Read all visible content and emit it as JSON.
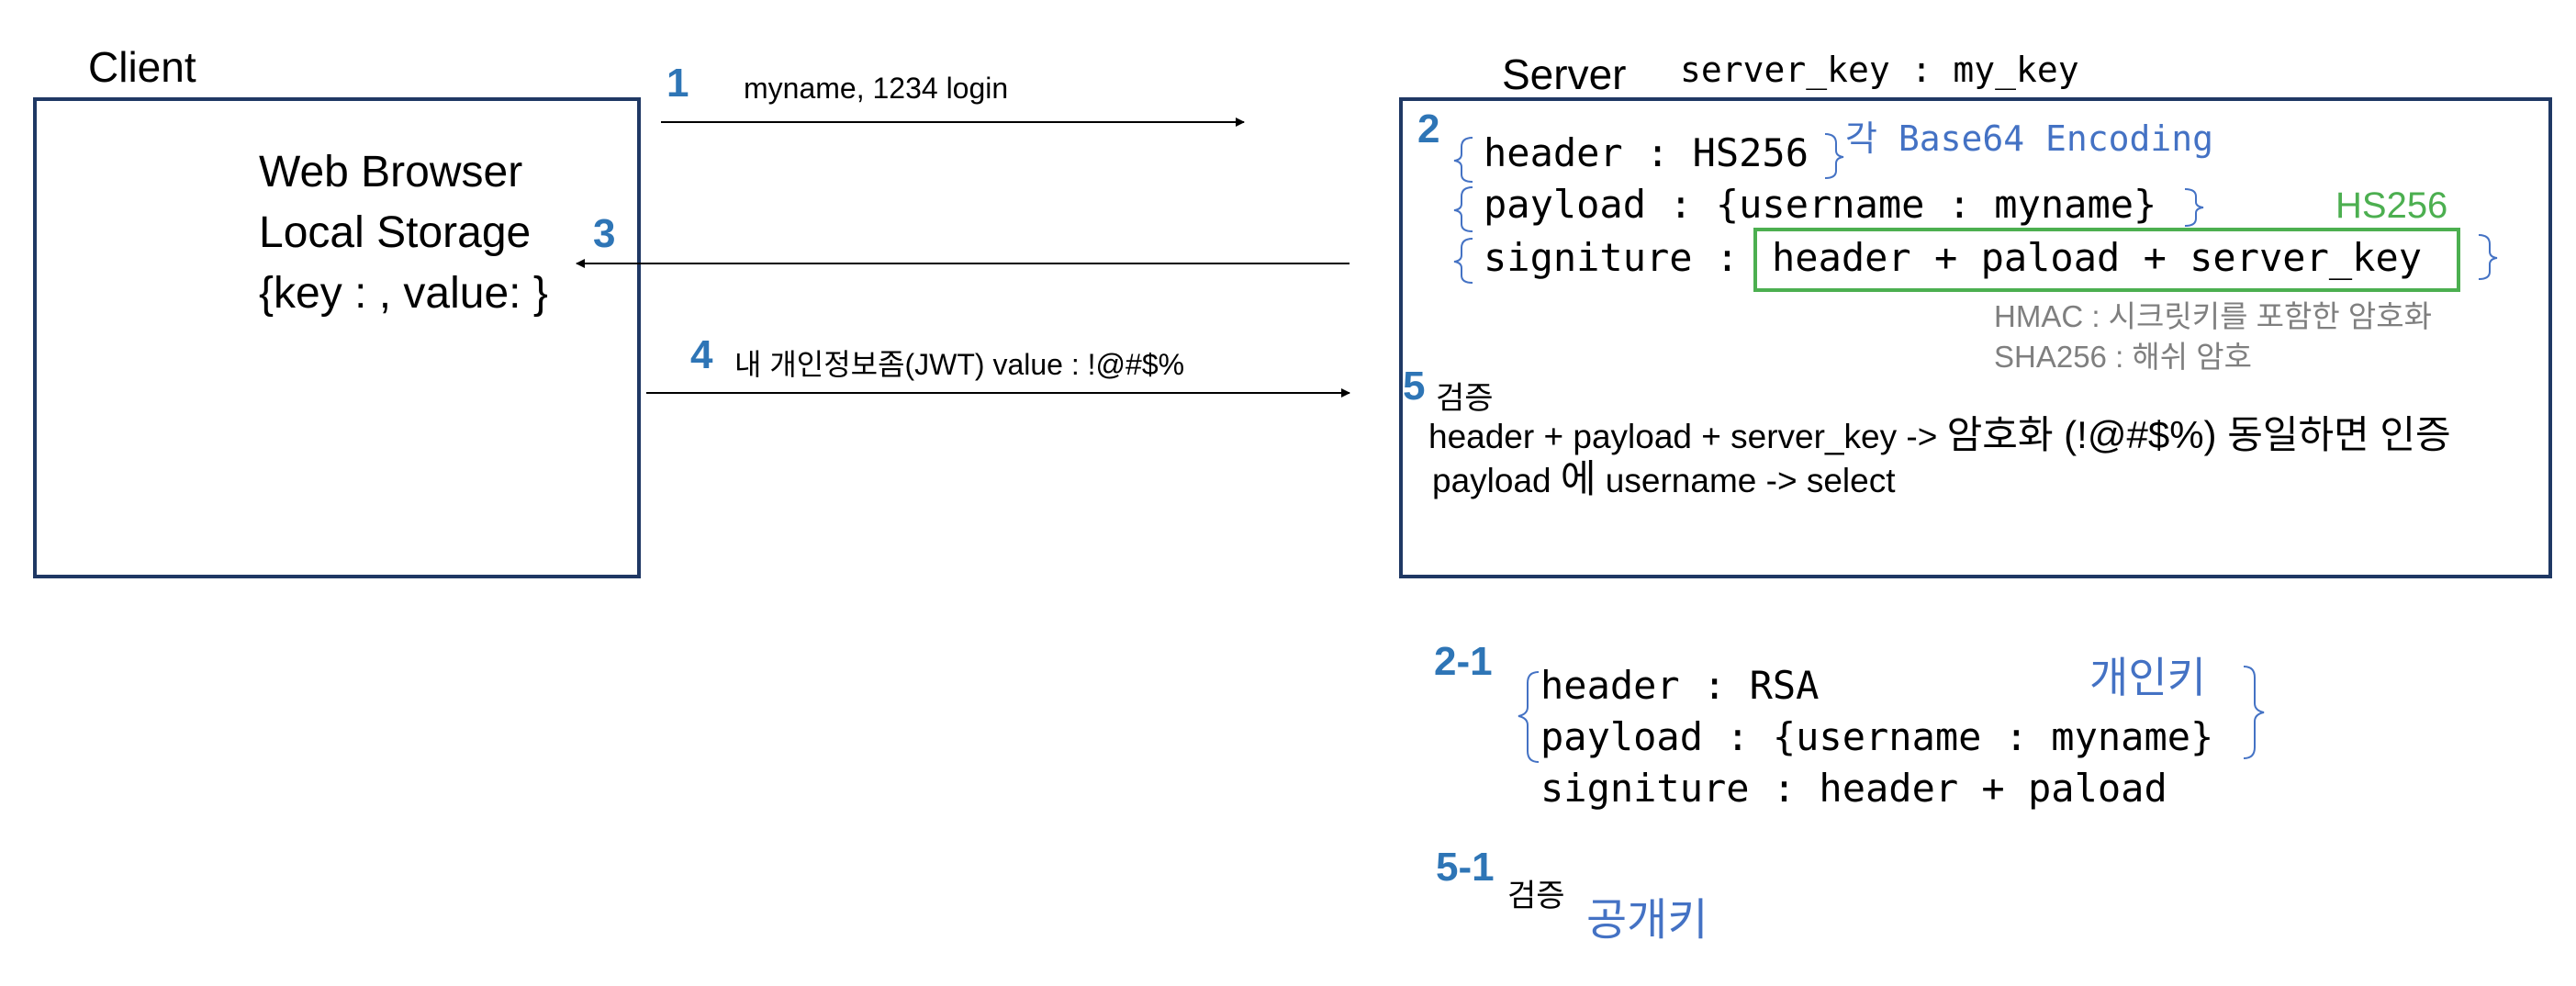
{
  "client": {
    "title": "Client",
    "line1": "Web Browser",
    "line2": "Local Storage",
    "line3": "{key : , value: }"
  },
  "server": {
    "title": "Server",
    "key_label": "server_key : my_key"
  },
  "steps": {
    "s1": {
      "num": "1",
      "text": "myname, 1234 login"
    },
    "s2": {
      "num": "2"
    },
    "s3": {
      "num": "3"
    },
    "s4": {
      "num": "4",
      "text": "내 개인정보좀(JWT) value : !@#$%"
    },
    "s5": {
      "num": "5",
      "label": "검증"
    },
    "s2_1": {
      "num": "2-1"
    },
    "s5_1": {
      "num": "5-1",
      "label": "검증"
    }
  },
  "jwt_hs": {
    "header": "header : HS256",
    "payload": "payload : {username : myname}",
    "sig_label": "signiture :",
    "sig_formula": "header + paload + server_key",
    "encoding_note": "각 Base64 Encoding",
    "alg_note": "HS256",
    "hmac_note": "HMAC : 시크릿키를 포함한 암호화",
    "sha_note": "SHA256 : 해쉬 암호"
  },
  "verify": {
    "line1_a": "header + payload + server_key -> ",
    "line1_b": "암호화 (!@#$%) 동일하면 인증",
    "line2_a": "payload ",
    "line2_b": "에",
    "line2_c": " username -> select"
  },
  "jwt_rsa": {
    "header": "header : RSA",
    "payload": "payload : {username : myname}",
    "signature": "signiture : header + paload",
    "private_key": "개인키",
    "public_key": "공개키"
  },
  "colors": {
    "box_border": "#1f3864",
    "step_number": "#2e75b6",
    "note_blue": "#4472c4",
    "green": "#4caf50",
    "gray": "#7f7f7f"
  }
}
